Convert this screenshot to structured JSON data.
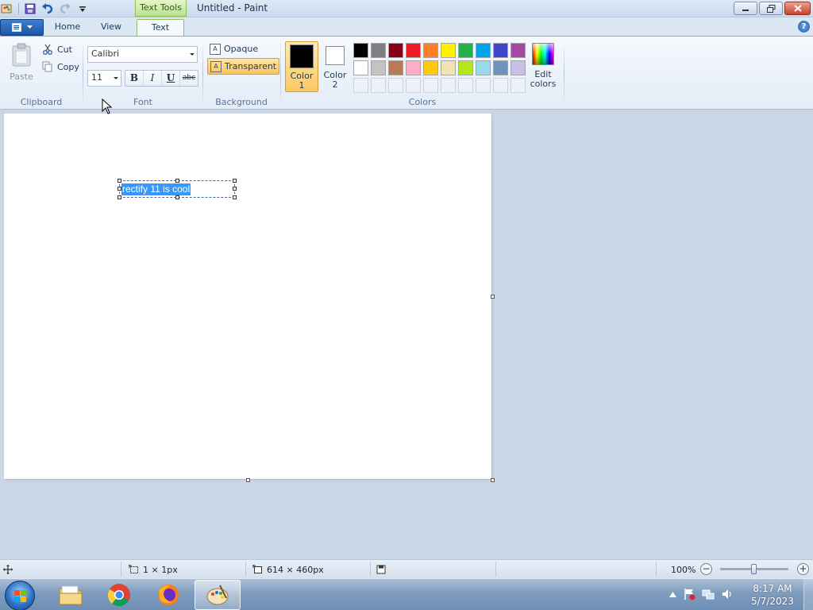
{
  "window": {
    "title": "Untitled - Paint",
    "context_tab": "Text Tools"
  },
  "tabs": {
    "home": "Home",
    "view": "View",
    "text": "Text",
    "active": "Text"
  },
  "clipboard": {
    "paste": "Paste",
    "cut": "Cut",
    "copy": "Copy",
    "label": "Clipboard"
  },
  "font": {
    "family": "Calibri",
    "size": "11",
    "bold": "B",
    "italic": "I",
    "underline": "U",
    "strikethrough": "abc",
    "label": "Font"
  },
  "background": {
    "opaque": "Opaque",
    "transparent": "Transparent",
    "selected": "Transparent",
    "label": "Background"
  },
  "colors": {
    "color1_label_top": "Color",
    "color1_label_bottom": "1",
    "color1_value": "#000000",
    "color2_label_top": "Color",
    "color2_label_bottom": "2",
    "color2_value": "#ffffff",
    "edit_top": "Edit",
    "edit_bottom": "colors",
    "label": "Colors",
    "palette_row1": [
      "#000000",
      "#7f7f7f",
      "#880015",
      "#ed1c24",
      "#ff7f27",
      "#fff200",
      "#22b14c",
      "#00a2e8",
      "#3f48cc",
      "#a349a4"
    ],
    "palette_row2": [
      "#ffffff",
      "#c3c3c3",
      "#b97a57",
      "#ffaec9",
      "#ffc90e",
      "#efe4b0",
      "#b5e61d",
      "#99d9ea",
      "#7092be",
      "#c8bfe7"
    ],
    "palette_row3": [
      "#eef2f8",
      "#eef2f8",
      "#eef2f8",
      "#eef2f8",
      "#eef2f8",
      "#eef2f8",
      "#eef2f8",
      "#eef2f8",
      "#eef2f8",
      "#eef2f8"
    ]
  },
  "canvas": {
    "text_content": "rectify 11 is cool"
  },
  "status": {
    "selection_size": "1 × 1px",
    "canvas_size": "614 × 460px",
    "zoom": "100%",
    "zoom_fraction": 0.5
  },
  "taskbar": {
    "time": "8:17 AM",
    "date": "5/7/2023"
  }
}
